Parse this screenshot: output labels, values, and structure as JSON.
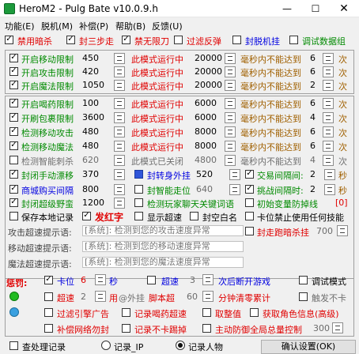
{
  "window": {
    "title": "HeroM2 - Pulg Bate v10.0.9.h",
    "min": "—",
    "max": "☐",
    "close": "✕"
  },
  "menu": [
    "功能(E)",
    "脱机(M)",
    "补偿(P)",
    "帮助(B)",
    "反馈(U)"
  ],
  "top_toggles": [
    {
      "label": "禁用暗杀",
      "checked": true,
      "color": "#e00000"
    },
    {
      "label": "封三步走",
      "checked": true,
      "color": "#e00000"
    },
    {
      "label": "禁无限刀",
      "checked": true,
      "color": "#e00000"
    },
    {
      "label": "过滤反弹",
      "checked": false,
      "color": "#e00000"
    },
    {
      "label": "封脱机挂",
      "checked": false,
      "color": "#0000e0"
    },
    {
      "label": "调试数据组",
      "checked": false,
      "color": "#008a00"
    }
  ],
  "speed_rows_1": [
    {
      "label": "开启移动限制",
      "checked": true,
      "value": "450",
      "mode": "此模式运行中",
      "ms": "20000",
      "cond": "毫秒内不能达到",
      "count": "6",
      "unit": "次"
    },
    {
      "label": "开启攻击限制",
      "checked": true,
      "value": "420",
      "mode": "此模式运行中",
      "ms": "20000",
      "cond": "毫秒内不能达到",
      "count": "6",
      "unit": "次"
    },
    {
      "label": "开启魔法限制",
      "checked": true,
      "value": "1050",
      "mode": "此模式运行中",
      "ms": "20000",
      "cond": "毫秒内不能达到",
      "count": "2",
      "unit": "次"
    }
  ],
  "speed_rows_2": [
    {
      "label": "开启喝药限制",
      "checked": true,
      "value": "100",
      "mode": "此模式运行中",
      "ms": "6000",
      "cond": "毫秒内不能达到",
      "count": "6",
      "unit": "次"
    },
    {
      "label": "开刷包裹限制",
      "checked": true,
      "value": "3600",
      "mode": "此模式运行中",
      "ms": "6000",
      "cond": "毫秒内不能达到",
      "count": "4",
      "unit": "次"
    },
    {
      "label": "检测移动攻击",
      "checked": true,
      "value": "480",
      "mode": "此模式运行中",
      "ms": "8000",
      "cond": "毫秒内不能达到",
      "count": "6",
      "unit": "次"
    },
    {
      "label": "检测移动魔法",
      "checked": true,
      "value": "480",
      "mode": "此模式运行中",
      "ms": "8000",
      "cond": "毫秒内不能达到",
      "count": "6",
      "unit": "次"
    },
    {
      "label": "检测智能刺杀",
      "checked": false,
      "value": "620",
      "mode": "此模式已关闭",
      "ms": "4800",
      "cond": "毫秒内不能达到",
      "count": "4",
      "unit": "次"
    }
  ],
  "row_sealwalk": {
    "label": "封闭手动漂移",
    "value": "370",
    "turn_label": "封转身外挂",
    "turn_value": "520",
    "trade_label": "交易间隔间:",
    "trade_value": "2",
    "trade_unit": "秒"
  },
  "row_shop": {
    "label": "商城购买间隔",
    "value": "800",
    "smart_label": "封智能走位",
    "smart_value": "640",
    "challenge_label": "挑战间隔时:",
    "challenge_value": "2",
    "challenge_unit": "秒"
  },
  "row_super": {
    "label": "封闭超级野蛮",
    "value": "1200",
    "chat_label": "检测玩家聊天关键词语",
    "init_label": "初始变量防掉线",
    "init_value": "[0]"
  },
  "row_save": {
    "save_label": "保存本地记录",
    "red_label": "发红字",
    "show_label": "显示超速",
    "white_label": "封空白名",
    "lock_label": "卡位禁止使用任何技能"
  },
  "tips": [
    {
      "label": "攻击超速提示语:",
      "text": "[系统]: 检测到您的攻击速度异常"
    },
    {
      "label": "移动超速提示语:",
      "text": "[系统]: 检测到您的移动速度异常"
    },
    {
      "label": "魔法超速提示语:",
      "text": "[系统]: 检测到您的魔法速度异常"
    }
  ],
  "seal_run": {
    "label": "封走跑暗杀挂",
    "value": "700"
  },
  "punish": {
    "title": "惩罚:",
    "row1": {
      "stuck_label": "卡位",
      "stuck_value": "6",
      "sec": "秒",
      "speed_label": "超速",
      "speed_value": "3",
      "after": "次后断开游戏",
      "debug_label": "调试模式"
    },
    "row2": {
      "speed_label": "超速",
      "speed_value": "2",
      "use": "用",
      "var": "@外挂",
      "script": "脚本超",
      "script_value": "60",
      "minutes": "分钟清零累计",
      "trigger": "触发不卡"
    },
    "row3": {
      "filter": "过滤引擎广告",
      "drink": "记录喝药超速",
      "cancel": "取整值",
      "grab": "获取角色信息(高级)"
    },
    "row4": {
      "comp": "补偿网络勿封",
      "notstuck": "记录不卡踢掉",
      "master": "主动防御全局总量控制",
      "master_value": "300"
    }
  },
  "bottom": {
    "view_label": "查处理记录",
    "radio_ip": "记录_IP",
    "radio_char": "记录人物",
    "confirm": "确认设置(OK)"
  }
}
